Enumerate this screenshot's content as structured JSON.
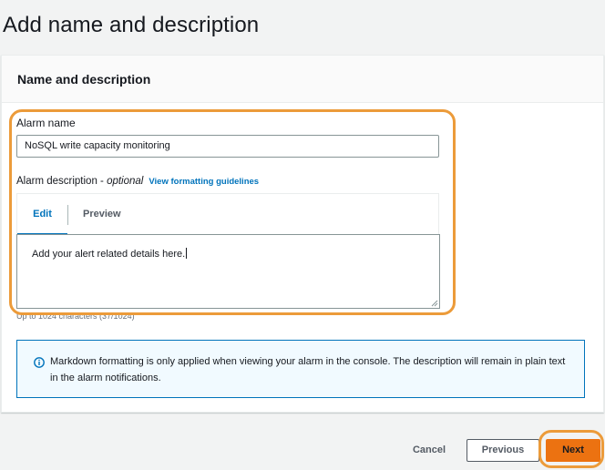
{
  "page": {
    "title": "Add name and description"
  },
  "panel": {
    "title": "Name and description"
  },
  "alarm_name": {
    "label": "Alarm name",
    "value": "NoSQL write capacity monitoring"
  },
  "alarm_description": {
    "label": "Alarm description - ",
    "optional": "optional",
    "link": "View formatting guidelines",
    "tabs": {
      "edit": "Edit",
      "preview": "Preview"
    },
    "value": "Add your alert related details here.",
    "char_count": "Up to 1024 characters (37/1024)"
  },
  "info": {
    "text": "Markdown formatting is only applied when viewing your alarm in the console. The description will remain in plain text in the alarm notifications."
  },
  "footer": {
    "cancel": "Cancel",
    "previous": "Previous",
    "next": "Next"
  },
  "colors": {
    "accent": "#0073bb",
    "primary_button": "#ec7211",
    "highlight": "#ec9b3a"
  },
  "icons": {
    "info": "info-circle-icon",
    "resize": "resize-handle-icon"
  }
}
